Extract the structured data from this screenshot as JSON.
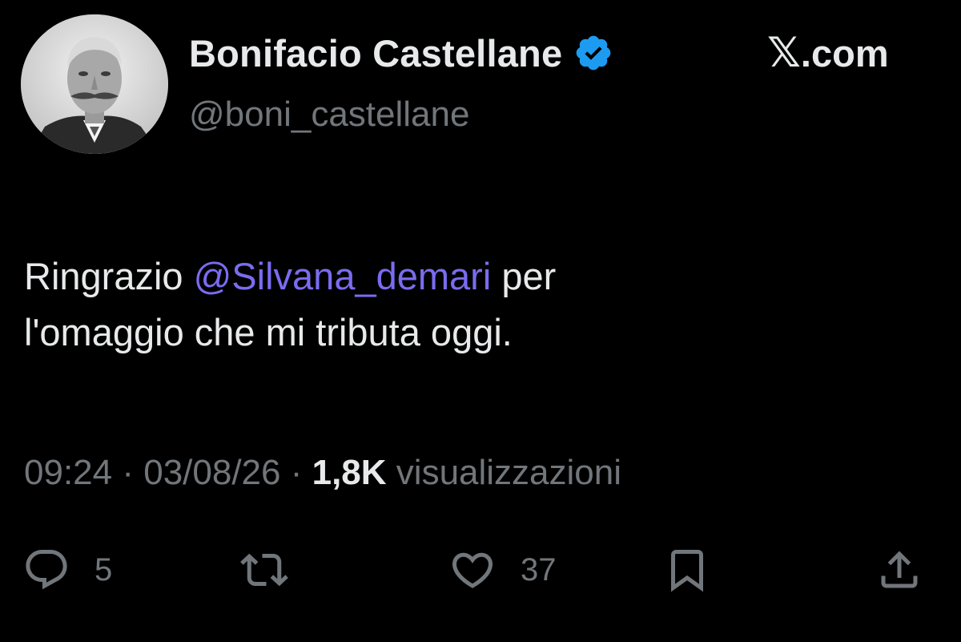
{
  "author": {
    "display_name": "Bonifacio Castellane",
    "handle": "@boni_castellane",
    "verified_icon": "verified-badge-icon",
    "verified_color": "#1d9bf0"
  },
  "source": {
    "logo": "𝕏",
    "domain": ".com"
  },
  "tweet": {
    "text_before_mention": "Ringrazio ",
    "mention": "@Silvana_demari",
    "text_after_mention": " per",
    "text_line2": "l'omaggio che mi tributa oggi.",
    "mention_color": "#7a6cf0"
  },
  "meta": {
    "time": "09:24",
    "separator": " · ",
    "date": "03/08/26",
    "views_count": "1,8K",
    "views_label": " visualizzazioni"
  },
  "actions": {
    "reply": {
      "icon": "reply-icon",
      "count": "5"
    },
    "retweet": {
      "icon": "retweet-icon",
      "count": ""
    },
    "like": {
      "icon": "heart-icon",
      "count": "37"
    },
    "bookmark": {
      "icon": "bookmark-icon",
      "count": ""
    },
    "share": {
      "icon": "share-icon",
      "count": ""
    }
  },
  "colors": {
    "background": "#000000",
    "primary_text": "#e7e9ea",
    "secondary_text": "#71767b"
  }
}
